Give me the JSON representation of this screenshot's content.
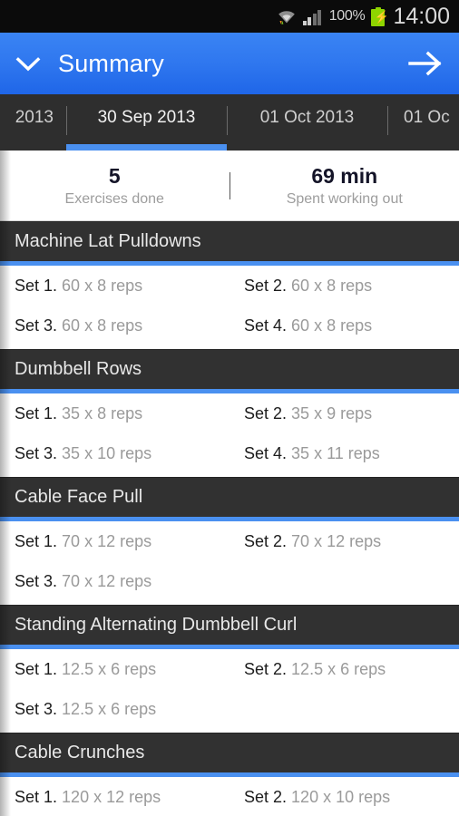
{
  "statusbar": {
    "wifi_icon": "wifi-icon",
    "signal_icon": "cellular-signal-icon",
    "battery_percent": "100%",
    "battery_icon": "battery-charging-icon",
    "time": "14:00"
  },
  "appbar": {
    "back_icon": "chevron-down-icon",
    "title": "Summary",
    "forward_icon": "arrow-right-icon"
  },
  "tabs": [
    {
      "label": "2013",
      "active": false
    },
    {
      "label": "30 Sep 2013",
      "active": true
    },
    {
      "label": "01 Oct 2013",
      "active": false
    },
    {
      "label": "01 Oc",
      "active": false
    }
  ],
  "summary": {
    "stats": [
      {
        "value": "5",
        "caption": "Exercises done"
      },
      {
        "value": "69 min",
        "caption": "Spent working out"
      }
    ]
  },
  "exercises": [
    {
      "name": "Machine Lat Pulldowns",
      "sets": [
        {
          "label": "Set 1.",
          "detail": "60 x 8 reps"
        },
        {
          "label": "Set 2.",
          "detail": "60 x 8 reps"
        },
        {
          "label": "Set 3.",
          "detail": "60 x 8 reps"
        },
        {
          "label": "Set 4.",
          "detail": "60 x 8 reps"
        }
      ]
    },
    {
      "name": "Dumbbell Rows",
      "sets": [
        {
          "label": "Set 1.",
          "detail": "35 x 8 reps"
        },
        {
          "label": "Set 2.",
          "detail": "35 x 9 reps"
        },
        {
          "label": "Set 3.",
          "detail": "35 x 10 reps"
        },
        {
          "label": "Set 4.",
          "detail": "35 x 11 reps"
        }
      ]
    },
    {
      "name": "Cable Face Pull",
      "sets": [
        {
          "label": "Set 1.",
          "detail": "70 x 12 reps"
        },
        {
          "label": "Set 2.",
          "detail": "70 x 12 reps"
        },
        {
          "label": "Set 3.",
          "detail": "70 x 12 reps"
        }
      ]
    },
    {
      "name": "Standing Alternating Dumbbell Curl",
      "sets": [
        {
          "label": "Set 1.",
          "detail": "12.5 x 6 reps"
        },
        {
          "label": "Set 2.",
          "detail": "12.5 x 6 reps"
        },
        {
          "label": "Set 3.",
          "detail": "12.5 x 6 reps"
        }
      ]
    },
    {
      "name": "Cable Crunches",
      "sets": [
        {
          "label": "Set 1.",
          "detail": "120 x 12 reps"
        },
        {
          "label": "Set 2.",
          "detail": "120 x 10 reps"
        }
      ]
    }
  ],
  "colors": {
    "accent": "#4a90f0",
    "appbar": "#2f77ef",
    "header_dark": "#313131",
    "tabstrip": "#2e2e2e",
    "statusbar": "#0b0b0b",
    "battery_green": "#8fd400",
    "muted_text": "#9a9a9a"
  }
}
